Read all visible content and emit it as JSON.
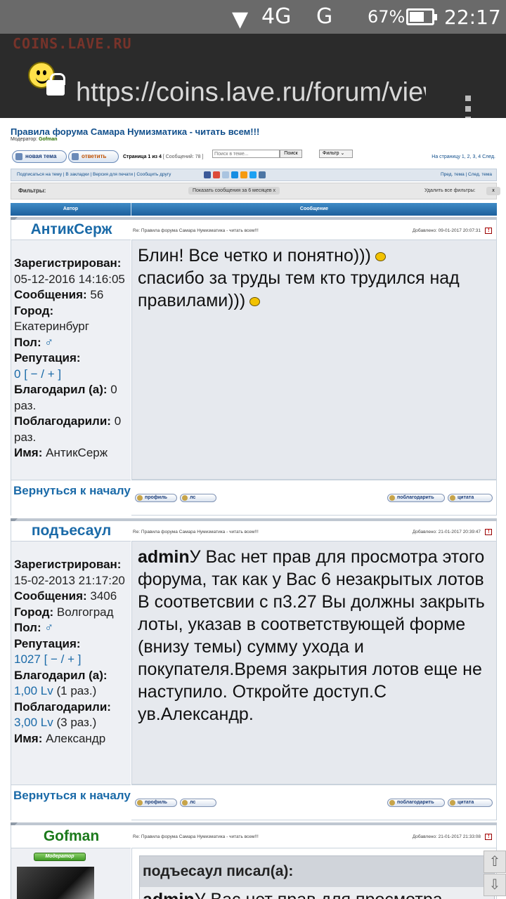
{
  "status_bar": {
    "network": "4G",
    "network2": "G",
    "battery": "67%",
    "time": "22:17"
  },
  "browser": {
    "brand": "COINS.LAVE.RU",
    "url": "https://coins.lave.ru/forum/viewtopic"
  },
  "topic": {
    "title": "Правила форума Самара Нумизматика - читать всем!!!",
    "moderator_label": "Модератор:",
    "moderator": "Gofman"
  },
  "buttons": {
    "new_topic": "новая тема",
    "reply": "ответить",
    "search_placeholder": "Поиск в теме...",
    "search": "Поиск",
    "filter": "Фильтр"
  },
  "pageinfo": {
    "page": "Страница 1 из 4",
    "count": "[ Сообщений: 78 ]"
  },
  "pages_nav": "На страницу 1, 2, 3, 4  След.",
  "toolbar": {
    "left": "Подписаться на тему | В закладки | Версия для печати | Сообщить другу",
    "right": "Пред. тема | След. тема"
  },
  "filters": {
    "label": "Фильтры:",
    "chip": "Показать сообщения за 6 месяцев  x",
    "remove_all": "Удалить все фильтры:",
    "x": "x"
  },
  "table_head": {
    "author": "Автор",
    "message": "Сообщение"
  },
  "posts": [
    {
      "author": "АнтикСерж",
      "subject": "Re: Правила форума Самара Нумизматика - читать всем!!!",
      "added": "Добавлено: 09-01-2017 20:07:31",
      "profile": {
        "registered_label": "Зарегистрирован:",
        "registered": "05-12-2016 14:16:05",
        "messages_label": "Сообщения:",
        "messages": "56",
        "city_label": "Город:",
        "city": "Екатеринбург",
        "sex_label": "Пол:",
        "sex": "♂",
        "rep_label": "Репутация:",
        "rep": "0",
        "rep_ctrl": "[ − / + ]",
        "thanked_label": "Благодарил (а):",
        "thanked": "0 раз.",
        "thanks_label": "Поблагодарили:",
        "thanks": "0 раз.",
        "name_label": "Имя:",
        "name": "АнтикСерж"
      },
      "body_line1": "Блин! Все четко и понятно)))",
      "body_line2": "спасибо за труды тем кто трудился над правилами)))",
      "back": "Вернуться к началу",
      "btn_profile": "профиль",
      "btn_pm": "лс",
      "btn_thank": "поблагодарить",
      "btn_quote": "цитата"
    },
    {
      "author": "подъесаул",
      "subject": "Re: Правила форума Самара Нумизматика - читать всем!!!",
      "added": "Добавлено: 21-01-2017 20:39:47",
      "profile": {
        "registered_label": "Зарегистрирован:",
        "registered": "15-02-2013 21:17:20",
        "messages_label": "Сообщения:",
        "messages": "3406",
        "city_label": "Город:",
        "city": "Волгоград",
        "sex_label": "Пол:",
        "sex": "♂",
        "rep_label": "Репутация:",
        "rep": "1027",
        "rep_ctrl": "[ − / + ]",
        "thanked_label": "Благодарил (а):",
        "thanked": "1,00 Lv",
        "thanked_times": "(1 раз.)",
        "thanks_label": "Поблагодарили:",
        "thanks": "3,00 Lv",
        "thanks_times": "(3 раз.)",
        "name_label": "Имя:",
        "name": "Александр"
      },
      "body_admin": "admin",
      "body_text": "У Вас нет прав для просмотра этого форума, так как у Вас 6 незакрытых лотов",
      "body_text2": "В соответсвии с п3.27 Вы должны закрыть лоты, указав в соответствующей форме (внизу темы) сумму ухода и покупателя.Время закрытия лотов еще не наступило. Откройте доступ.С ув.Александр.",
      "back": "Вернуться к началу",
      "btn_profile": "профиль",
      "btn_pm": "лс",
      "btn_thank": "поблагодарить",
      "btn_quote": "цитата"
    },
    {
      "author": "Gofman",
      "subject": "Re: Правила форума Самара Нумизматика - читать всем!!!",
      "added": "Добавлено: 21-01-2017 21:33:08",
      "badge": "Модератор",
      "quote_title": "подъесаул писал(а):",
      "quote_admin": "admin",
      "quote_text": "У Вас нет прав для просмотра"
    }
  ],
  "scroll": {
    "up": "⇧",
    "down": "⇩"
  }
}
